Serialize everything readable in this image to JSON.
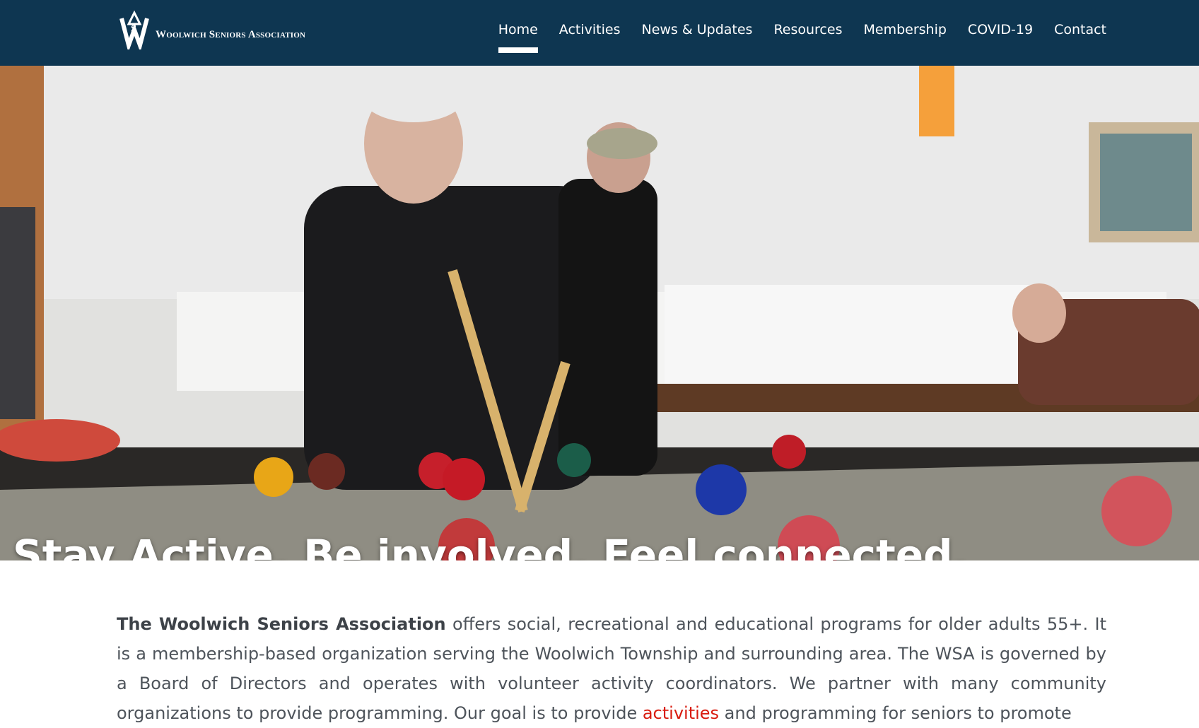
{
  "site": {
    "logo_text": "Woolwich Seniors Association"
  },
  "nav": {
    "items": [
      {
        "label": "Home",
        "active": true
      },
      {
        "label": "Activities",
        "active": false
      },
      {
        "label": "News & Updates",
        "active": false
      },
      {
        "label": "Resources",
        "active": false
      },
      {
        "label": "Membership",
        "active": false
      },
      {
        "label": "COVID-19",
        "active": false
      },
      {
        "label": "Contact",
        "active": false
      }
    ]
  },
  "hero": {
    "caption": "Stay Active. Be involved. Feel connected."
  },
  "intro": {
    "org_name": "The Woolwich Seniors Association",
    "text_1": " offers social, recreational and educational programs for older adults 55+. It is a membership-based organization serving the Woolwich Township and surrounding area. The WSA is governed by a Board of Directors and operates with volunteer activity coordinators. We partner with many community organizations to provide programming. Our goal is to provide ",
    "link_label": "activities",
    "text_2": " and programming for seniors to promote"
  },
  "colors": {
    "header_bg": "#0e3651",
    "link": "#d81b0f",
    "body_text": "#4e545b"
  }
}
